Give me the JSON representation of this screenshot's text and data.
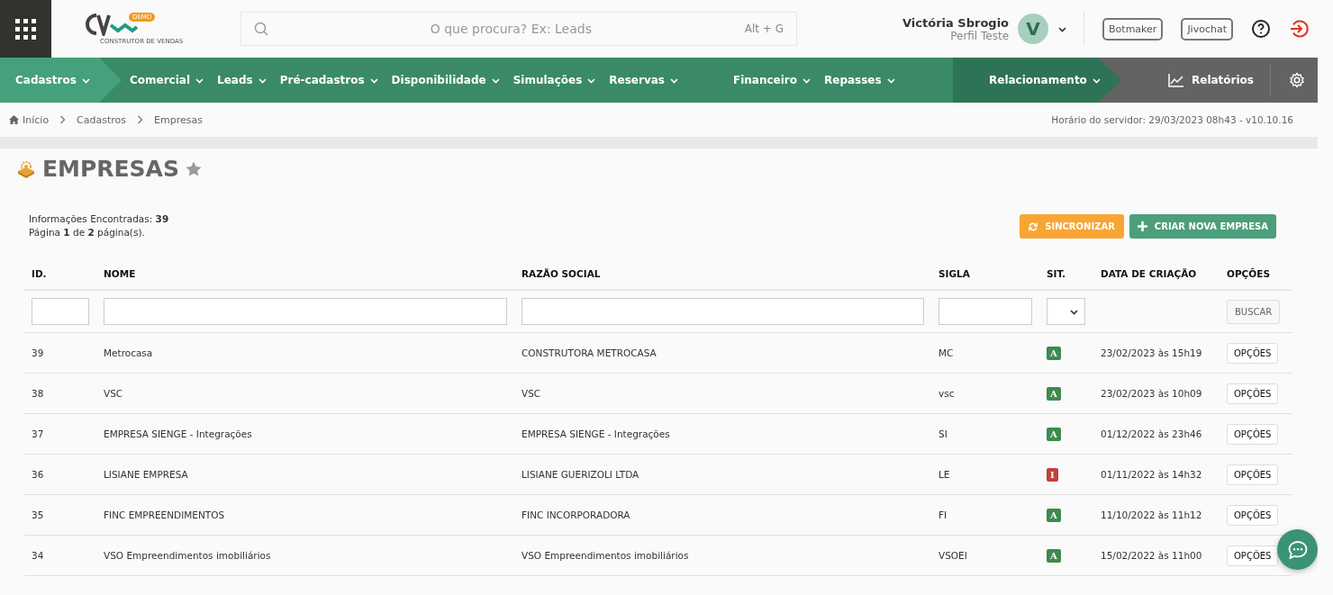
{
  "header": {
    "logo": {
      "badge": "DEMO",
      "tagline": "CONSTRUTOR DE VENDAS"
    },
    "search": {
      "placeholder": "O que procura? Ex: Leads",
      "shortcut": "Alt + G"
    },
    "user": {
      "name": "Victória Sbrogio",
      "profile": "Perfil Teste",
      "initial": "V"
    },
    "buttons": [
      "Botmaker",
      "Jivochat"
    ]
  },
  "nav": {
    "groups": [
      {
        "kind": "active",
        "items": [
          "Cadastros"
        ]
      },
      {
        "kind": "main",
        "items": [
          "Comercial",
          "Leads",
          "Pré-cadastros",
          "Disponibilidade",
          "Simulações",
          "Reservas",
          "Financeiro",
          "Repasses"
        ]
      },
      {
        "kind": "dark",
        "items": [
          "Relacionamento"
        ]
      }
    ],
    "reports": "Relatórios"
  },
  "breadcrumb": [
    "Início",
    "Cadastros",
    "Empresas"
  ],
  "server_time": "Horário do servidor: 29/03/2023 08h43 - v10.10.16",
  "page": {
    "title": "EMPRESAS",
    "favorite": false
  },
  "summary": [
    "Informações Encontradas: **39**",
    "Página **1** de **2** página(s)."
  ],
  "actions": [
    {
      "kind": "warning",
      "label": "SINCRONIZAR"
    },
    {
      "kind": "success",
      "label": "CRIAR NOVA EMPRESA"
    }
  ],
  "table": {
    "columns": [
      {
        "label": "ID.",
        "kind": "text"
      },
      {
        "label": "NOME",
        "kind": "text"
      },
      {
        "label": "RAZÃO SOCIAL",
        "kind": "text"
      },
      {
        "label": "SIGLA",
        "kind": "text"
      },
      {
        "label": "SIT.",
        "kind": "select"
      },
      {
        "label": "DATA DE CRIAÇÃO",
        "kind": "none"
      },
      {
        "label": "OPÇÕES",
        "kind": "button"
      }
    ],
    "search_button": "BUSCAR",
    "rows": [
      {
        "id": "39",
        "name": "Metrocasa",
        "company": "CONSTRUTORA METROCASA",
        "code": "MC",
        "status": "A",
        "color": "#3e8a4f",
        "created": "23/02/2023 às 15h19",
        "options": "OPÇÕES"
      },
      {
        "id": "38",
        "name": "VSC",
        "company": "VSC",
        "code": "vsc",
        "status": "A",
        "color": "#3e8a4f",
        "created": "23/02/2023 às 10h09",
        "options": "OPÇÕES"
      },
      {
        "id": "37",
        "name": "EMPRESA SIENGE - Integrações",
        "company": "EMPRESA SIENGE - Integrações",
        "code": "SI",
        "status": "A",
        "color": "#3e8a4f",
        "created": "01/12/2022 às 23h46",
        "options": "OPÇÕES"
      },
      {
        "id": "36",
        "name": "LISIANE EMPRESA",
        "company": "LISIANE GUERIZOLI LTDA",
        "code": "LE",
        "status": "I",
        "color": "#c0403f",
        "created": "01/11/2022 às 14h32",
        "options": "OPÇÕES"
      },
      {
        "id": "35",
        "name": "FINC EMPREENDIMENTOS",
        "company": "FINC INCORPORADORA",
        "code": "FI",
        "status": "A",
        "color": "#3e8a4f",
        "created": "11/10/2022 às 11h12",
        "options": "OPÇÕES"
      },
      {
        "id": "34",
        "name": "VSO Empreendimentos imobiliários",
        "company": "VSO Empreendimentos imobiliários",
        "code": "VSOEI",
        "status": "A",
        "color": "#3e8a4f",
        "created": "15/02/2022 às 11h00",
        "options": "OPÇÕES"
      }
    ]
  }
}
